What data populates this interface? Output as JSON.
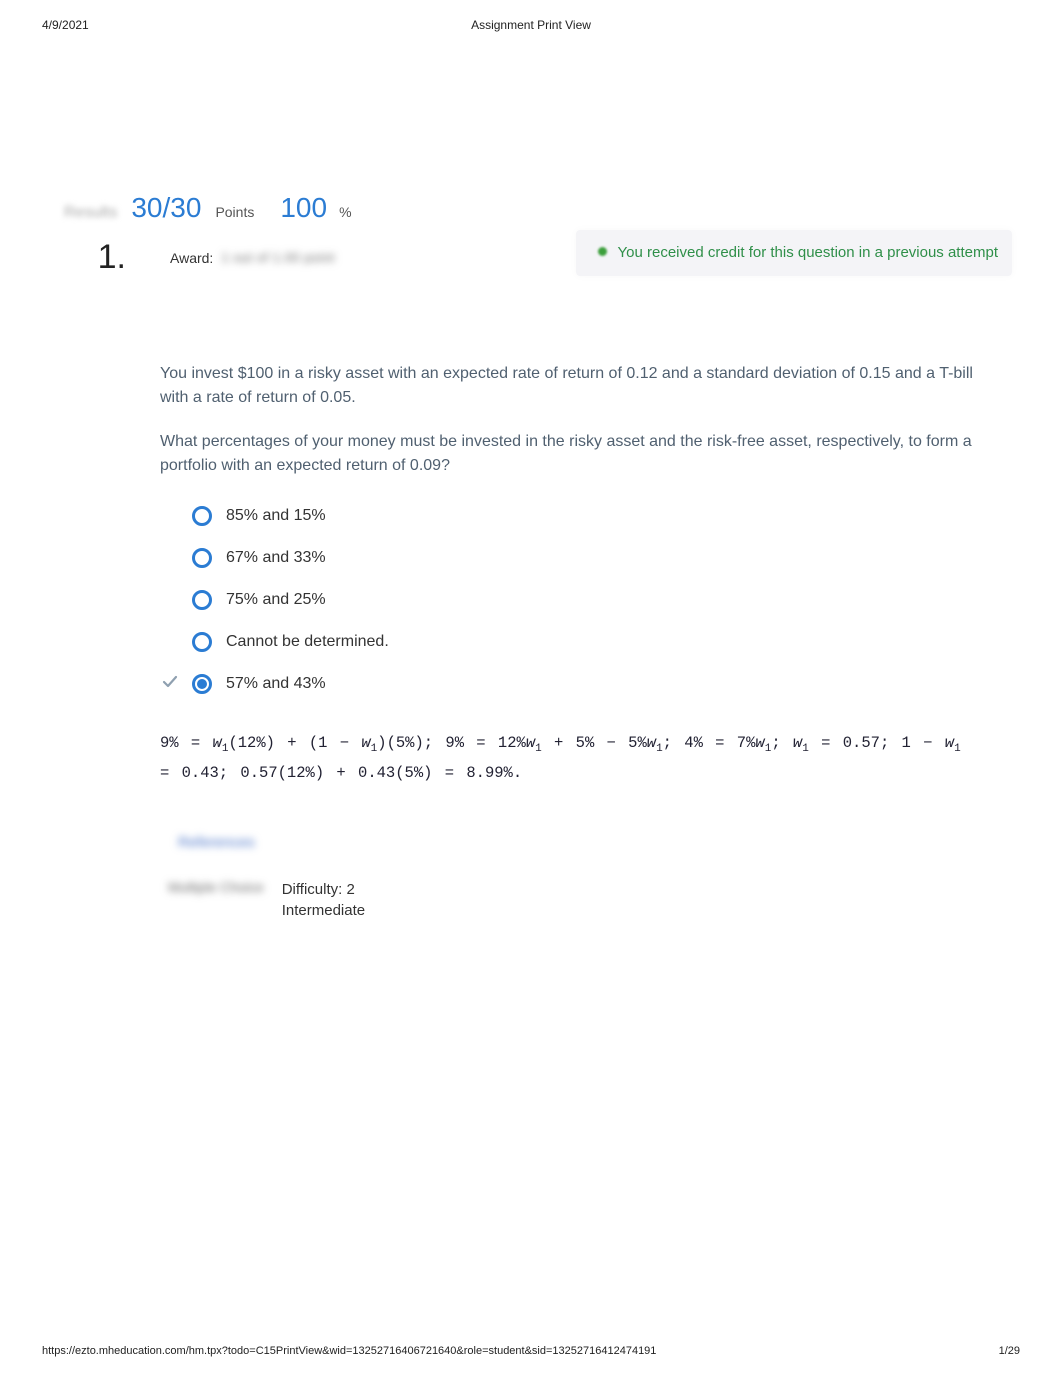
{
  "header": {
    "date": "4/9/2021",
    "title": "Assignment Print View"
  },
  "score": {
    "label_blur": "Results",
    "points": "30/30",
    "points_label": "Points",
    "percent": "100",
    "percent_sym": "%"
  },
  "question": {
    "number": "1.",
    "award_label": "Award:",
    "award_blur": "1 out of 1.00 point",
    "credit_msg": "You received credit for this question in a previous attempt",
    "text1": "You invest $100 in a risky asset with an expected rate of return of 0.12 and a standard deviation of 0.15 and a T-bill with a rate of return of 0.05.",
    "text2": "What percentages of your money must be invested in the risky asset and the risk-free asset, respectively, to form a portfolio with an expected return of 0.09?",
    "options": [
      {
        "label": "85% and 15%",
        "selected": false,
        "correct": false
      },
      {
        "label": "67% and 33%",
        "selected": false,
        "correct": false
      },
      {
        "label": "75% and 25%",
        "selected": false,
        "correct": false
      },
      {
        "label": "Cannot be determined.",
        "selected": false,
        "correct": false
      },
      {
        "label": "57% and 43%",
        "selected": true,
        "correct": true
      }
    ],
    "solution": "9% = w₁(12%) + (1 − w₁)(5%); 9% = 12%w₁ + 5% − 5%w₁; 4% = 7%w₁; w₁ = 0.57; 1 − w₁ = 0.43; 0.57(12%) + 0.43(5%) = 8.99%.",
    "reference_blur": "References",
    "meta_blur": "Multiple Choice",
    "difficulty": "Difficulty: 2 Intermediate"
  },
  "footer": {
    "url": "https://ezto.mheducation.com/hm.tpx?todo=C15PrintView&wid=13252716406721640&role=student&sid=13252716412474191",
    "page": "1/29"
  }
}
